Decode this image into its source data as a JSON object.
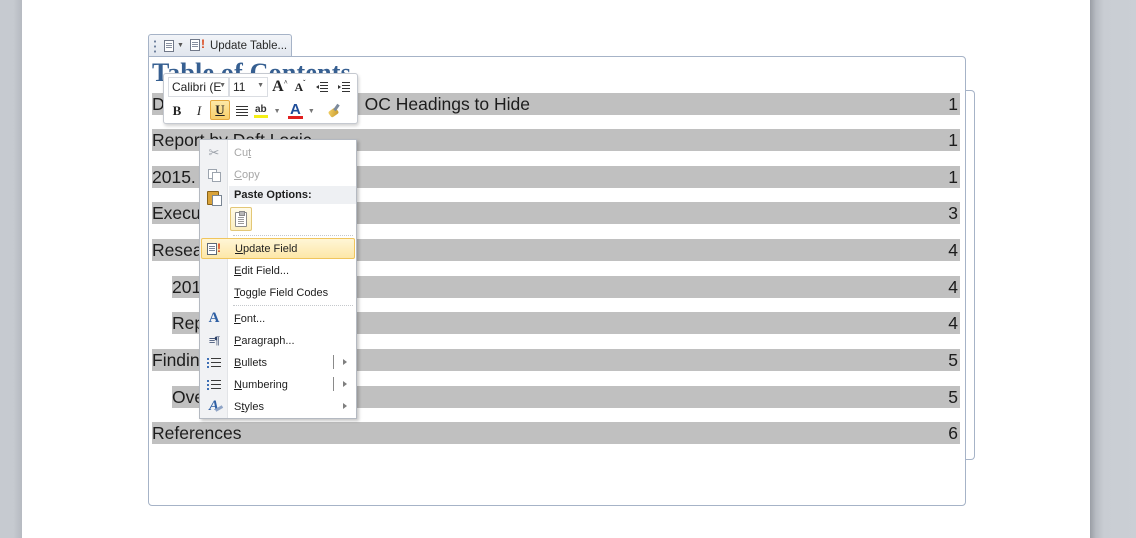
{
  "field_tab": {
    "update_label": "Update Table..."
  },
  "document": {
    "toc_title": "Table of Contents",
    "entries": [
      {
        "visible_text": "D",
        "hidden_part_text": "OC Headings to Hide",
        "page": "1",
        "level": 1
      },
      {
        "visible_text": "Report by Daft Logic",
        "page": "1",
        "level": 1
      },
      {
        "visible_text": "2015.",
        "page": "1",
        "level": 1
      },
      {
        "visible_text": "Execu",
        "page": "3",
        "level": 1
      },
      {
        "visible_text": "Resea",
        "page": "4",
        "level": 1
      },
      {
        "visible_text": "201",
        "page": "4",
        "level": 2
      },
      {
        "visible_text": "Rep",
        "page": "4",
        "level": 2
      },
      {
        "visible_text": "Findin",
        "page": "5",
        "level": 1
      },
      {
        "visible_text": "Ove",
        "page": "5",
        "level": 2
      },
      {
        "visible_text": "References",
        "page": "6",
        "level": 1
      }
    ]
  },
  "mini_toolbar": {
    "font_name": "Calibri (E",
    "font_size": "11",
    "grow_font_icon": "A",
    "shrink_font_icon": "A",
    "bold": "B",
    "italic": "I",
    "underline": "U",
    "underline_active": true,
    "highlight_icon": "ab",
    "font_color_icon": "A",
    "highlight_color": "#f4ef16",
    "font_color": "#e02020"
  },
  "context_menu": {
    "items": [
      {
        "label": "Cut",
        "icon": "scissors-icon",
        "enabled": false
      },
      {
        "label": "Copy",
        "icon": "copy-icon",
        "enabled": false
      },
      {
        "header": "Paste Options:"
      },
      {
        "label": "Update Field",
        "icon": "update-field-icon",
        "enabled": true,
        "highlighted": true
      },
      {
        "label": "Edit Field...",
        "enabled": true
      },
      {
        "label": "Toggle Field Codes",
        "enabled": true
      },
      {
        "label": "Font...",
        "icon": "font-icon",
        "enabled": true
      },
      {
        "label": "Paragraph...",
        "icon": "paragraph-icon",
        "enabled": true
      },
      {
        "label": "Bullets",
        "icon": "bullets-icon",
        "enabled": true,
        "submenu": true
      },
      {
        "label": "Numbering",
        "icon": "numbering-icon",
        "enabled": true,
        "submenu": true
      },
      {
        "label": "Styles",
        "icon": "styles-icon",
        "enabled": true,
        "submenu": true
      }
    ]
  },
  "colors": {
    "title_blue": "#365f91",
    "field_shading": "#c0c0c0",
    "menu_highlight": "#fde7a8"
  }
}
